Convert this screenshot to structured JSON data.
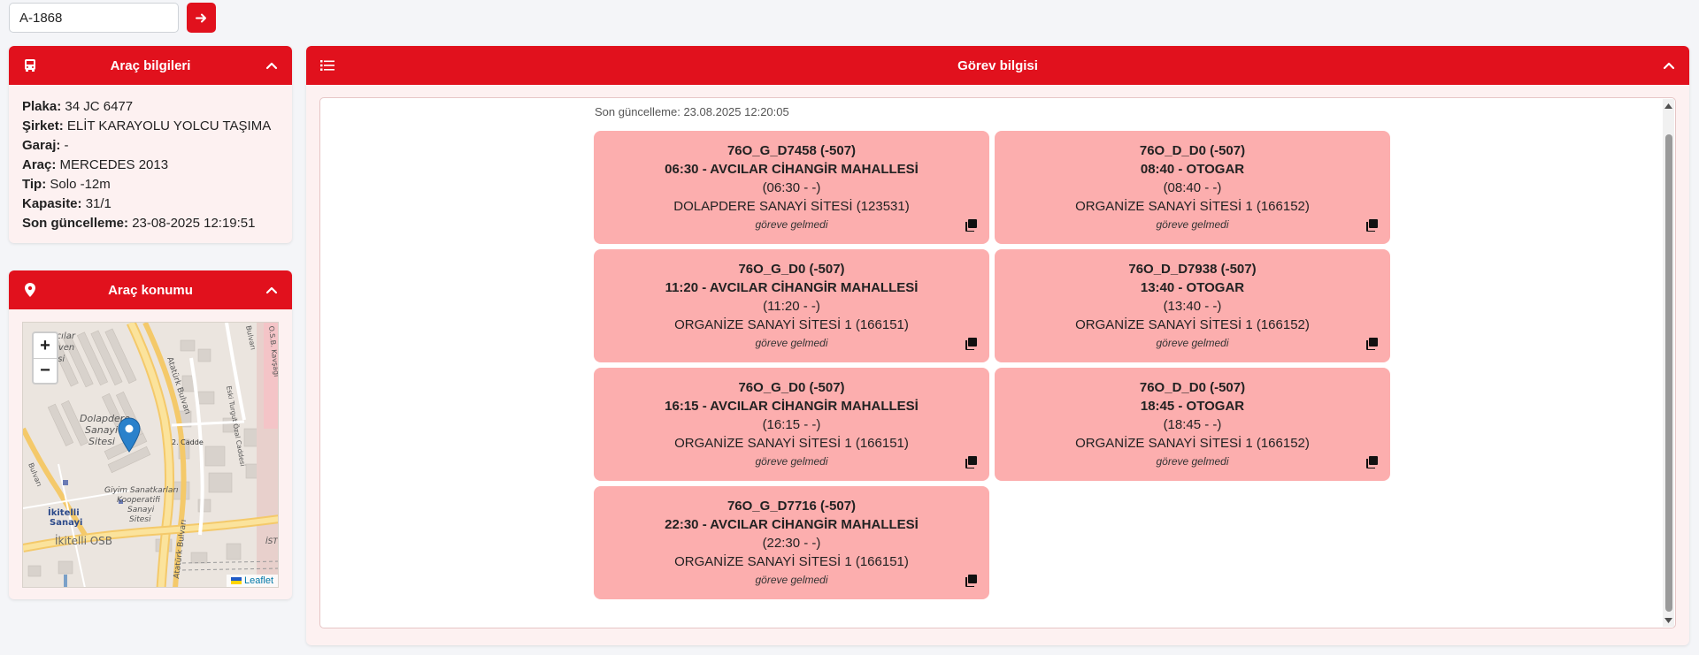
{
  "search": {
    "value": "A-1868"
  },
  "vehicle_info": {
    "title": "Araç bilgileri",
    "rows": [
      {
        "label": "Plaka:",
        "value": "34 JC 6477"
      },
      {
        "label": "Şirket:",
        "value": "ELİT KARAYOLU YOLCU TAŞIMA"
      },
      {
        "label": "Garaj:",
        "value": "-"
      },
      {
        "label": "Araç:",
        "value": "MERCEDES 2013"
      },
      {
        "label": "Tip:",
        "value": "Solo -12m"
      },
      {
        "label": "Kapasite:",
        "value": "31/1"
      },
      {
        "label": "Son güncelleme:",
        "value": "23-08-2025 12:19:51"
      }
    ]
  },
  "vehicle_location": {
    "title": "Araç konumu",
    "zoom_in": "+",
    "zoom_out": "−",
    "attribution": "Leaflet",
    "map_labels": {
      "dolapdere": [
        "Dolapdere",
        "Sanayi",
        "Sitesi"
      ],
      "ataturk_1": "Atatürk Bulvarı",
      "ataturk_2": "Atatürk Bulvarı",
      "turgut": "Eski Turgut Özal Caddesi",
      "cadde2": "2. Cadde",
      "giyim": [
        "Giyim Sanatkarları",
        "Kooperatifi",
        "Sanayi",
        "Sitesi"
      ],
      "ikitelli_sanayi": [
        "İkitelli",
        "Sanayi"
      ],
      "ikitelli_osb": "İkitelli OSB",
      "top_left": [
        "Bakırcılar",
        "Döven",
        "Sitesi"
      ],
      "osb": "O.S.B. Kavşağı",
      "bulvari": "Bulvarı",
      "ist": "İST",
      "left_road": "Bulvarı"
    }
  },
  "task_info": {
    "title": "Görev bilgisi",
    "last_updated": "Son güncelleme: 23.08.2025 12:20:05",
    "tasks": [
      {
        "code": "76O_G_D7458 (-507)",
        "time_route": "06:30 - AVCILAR CİHANGİR MAHALLESİ",
        "actual": "(06:30 - -)",
        "garage": "DOLAPDERE SANAYİ SİTESİ (123531)",
        "status": "göreve gelmedi"
      },
      {
        "code": "76O_D_D0 (-507)",
        "time_route": "08:40 - OTOGAR",
        "actual": "(08:40 - -)",
        "garage": "ORGANİZE SANAYİ SİTESİ 1 (166152)",
        "status": "göreve gelmedi"
      },
      {
        "code": "76O_G_D0 (-507)",
        "time_route": "11:20 - AVCILAR CİHANGİR MAHALLESİ",
        "actual": "(11:20 - -)",
        "garage": "ORGANİZE SANAYİ SİTESİ 1 (166151)",
        "status": "göreve gelmedi"
      },
      {
        "code": "76O_D_D7938 (-507)",
        "time_route": "13:40 - OTOGAR",
        "actual": "(13:40 - -)",
        "garage": "ORGANİZE SANAYİ SİTESİ 1 (166152)",
        "status": "göreve gelmedi"
      },
      {
        "code": "76O_G_D0 (-507)",
        "time_route": "16:15 - AVCILAR CİHANGİR MAHALLESİ",
        "actual": "(16:15 - -)",
        "garage": "ORGANİZE SANAYİ SİTESİ 1 (166151)",
        "status": "göreve gelmedi"
      },
      {
        "code": "76O_D_D0 (-507)",
        "time_route": "18:45 - OTOGAR",
        "actual": "(18:45 - -)",
        "garage": "ORGANİZE SANAYİ SİTESİ 1 (166152)",
        "status": "göreve gelmedi"
      },
      {
        "code": "76O_G_D7716 (-507)",
        "time_route": "22:30 - AVCILAR CİHANGİR MAHALLESİ",
        "actual": "(22:30 - -)",
        "garage": "ORGANİZE SANAYİ SİTESİ 1 (166151)",
        "status": "göreve gelmedi"
      }
    ]
  },
  "colors": {
    "accent": "#e1111d",
    "task_card": "#fcaeae",
    "panel_bg": "#fdf1f1"
  }
}
